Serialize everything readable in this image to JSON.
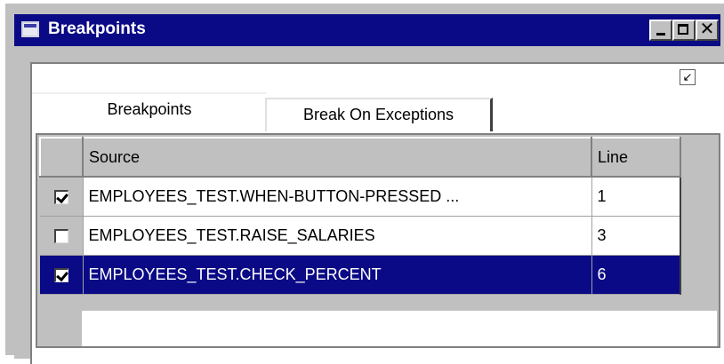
{
  "window": {
    "title": "Breakpoints",
    "controls": {
      "minimize": "minimize-icon",
      "maximize": "maximize-icon",
      "close": "✕"
    }
  },
  "dock_icon": "↙",
  "tabs": [
    {
      "label": "Breakpoints",
      "active": true
    },
    {
      "label": "Break On Exceptions",
      "active": false
    }
  ],
  "grid": {
    "columns": [
      "Source",
      "Line"
    ],
    "rows": [
      {
        "checked": true,
        "source": "EMPLOYEES_TEST.WHEN-BUTTON-PRESSED ...",
        "line": "1",
        "selected": false
      },
      {
        "checked": false,
        "source": "EMPLOYEES_TEST.RAISE_SALARIES",
        "line": "3",
        "selected": false
      },
      {
        "checked": true,
        "source": "EMPLOYEES_TEST.CHECK_PERCENT",
        "line": "6",
        "selected": true
      }
    ]
  },
  "colors": {
    "titlebar": "#0a0a86",
    "selection": "#0a0a86",
    "chrome": "#c0c0c0"
  }
}
